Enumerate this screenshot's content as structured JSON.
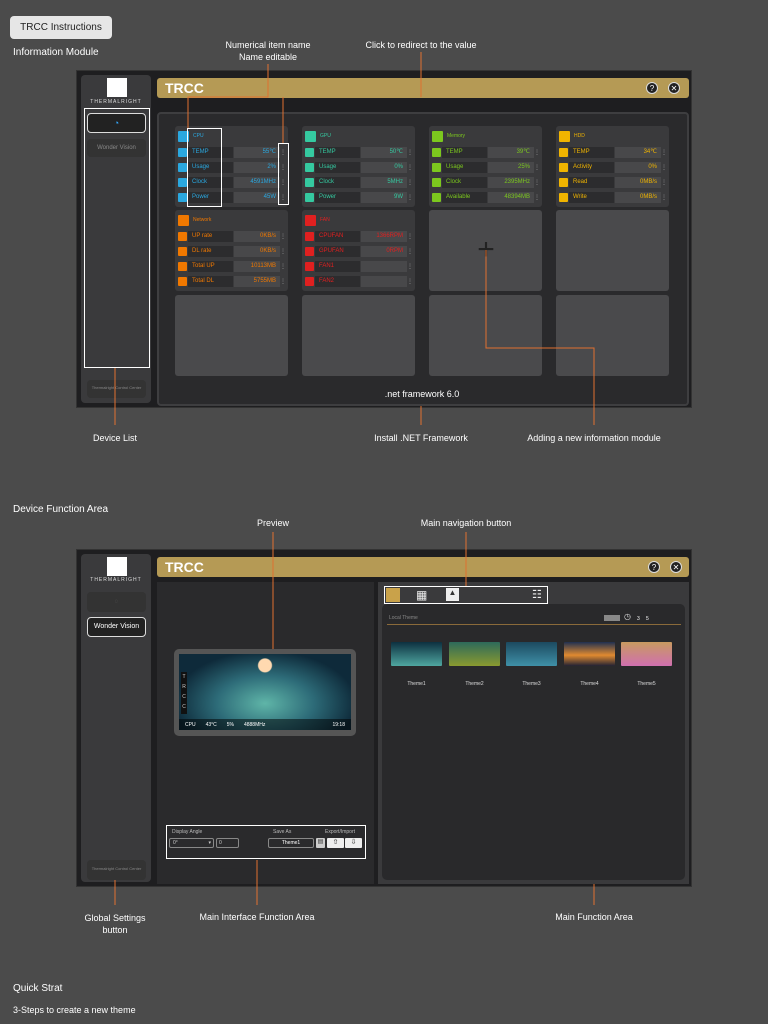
{
  "header": {
    "instructions_button": "TRCC Instructions"
  },
  "sections": {
    "info": "Information Module",
    "device": "Device Function Area",
    "quick": "Quick Strat",
    "steps": "3-Steps to create a new theme"
  },
  "annotations": {
    "item_name": "Numerical item name",
    "name_editable": "Name editable",
    "redirect": "Click to redirect to the value",
    "device_list": "Device List",
    "install_net": "Install .NET Framework",
    "add_module": "Adding a new information module",
    "preview": "Preview",
    "main_nav": "Main navigation button",
    "global_settings": "Global Settings button",
    "main_interface": "Main Interface Function Area",
    "main_function": "Main Function Area"
  },
  "app": {
    "title": "TRCC",
    "brand": "THERMALRIGHT",
    "help_icon": "?",
    "close_icon": "✕",
    "wonder_vision": "Wonder Vision",
    "control_center": "Thermalright Control Center",
    "footer": ".net framework 6.0",
    "add_symbol": "+"
  },
  "colors": {
    "cpu": "#2aa8e0",
    "gpu": "#35c9a0",
    "memory": "#7cc81e",
    "hdd": "#f0b400",
    "network": "#f07800",
    "fan": "#e02020",
    "annotation": "#e07030",
    "accent": "#b59a55"
  },
  "modules": [
    {
      "title": "CPU",
      "color": "#2aa8e0",
      "rows": [
        {
          "name": "TEMP",
          "value": "55℃"
        },
        {
          "name": "Usage",
          "value": "2%"
        },
        {
          "name": "Clock",
          "value": "4591MHz"
        },
        {
          "name": "Power",
          "value": "45W"
        }
      ]
    },
    {
      "title": "GPU",
      "color": "#35c9a0",
      "rows": [
        {
          "name": "TEMP",
          "value": "50℃"
        },
        {
          "name": "Usage",
          "value": "0%"
        },
        {
          "name": "Clock",
          "value": "5MHz"
        },
        {
          "name": "Power",
          "value": "9W"
        }
      ]
    },
    {
      "title": "Memory",
      "color": "#7cc81e",
      "rows": [
        {
          "name": "TEMP",
          "value": "39℃"
        },
        {
          "name": "Usage",
          "value": "25%"
        },
        {
          "name": "Clock",
          "value": "2395MHz"
        },
        {
          "name": "Available",
          "value": "48394MB"
        }
      ]
    },
    {
      "title": "HDD",
      "color": "#f0b400",
      "rows": [
        {
          "name": "TEMP",
          "value": "34℃"
        },
        {
          "name": "Activity",
          "value": "0%"
        },
        {
          "name": "Read",
          "value": "0MB/s"
        },
        {
          "name": "Write",
          "value": "0MB/s"
        }
      ]
    },
    {
      "title": "Network",
      "color": "#f07800",
      "rows": [
        {
          "name": "UP rate",
          "value": "0KB/s"
        },
        {
          "name": "DL rate",
          "value": "0KB/s"
        },
        {
          "name": "Total UP",
          "value": "10113MB"
        },
        {
          "name": "Total DL",
          "value": "5755MB"
        }
      ]
    },
    {
      "title": "FAN",
      "color": "#e02020",
      "rows": [
        {
          "name": "CPUFAN",
          "value": "1366RPM"
        },
        {
          "name": "GPUFAN",
          "value": "0RPM"
        },
        {
          "name": "FAN1",
          "value": ""
        },
        {
          "name": "FAN2",
          "value": ""
        }
      ]
    }
  ],
  "preview": {
    "vertical": "TRCC",
    "cpu": "CPU",
    "temp": "43°C",
    "usage": "5%",
    "clock": "4888MHz",
    "time": "19:18"
  },
  "controls": {
    "display_angle_label": "Display Angle",
    "display_angle": "0°",
    "angle_extra": "0",
    "save_as_label": "Save As",
    "save_as_value": "Theme1",
    "export_import_label": "Export/Import"
  },
  "themes": {
    "header": "Local Theme",
    "count_a": "3",
    "count_b": "5",
    "items": [
      "Theme1",
      "Theme2",
      "Theme3",
      "Theme4",
      "Theme5"
    ]
  }
}
